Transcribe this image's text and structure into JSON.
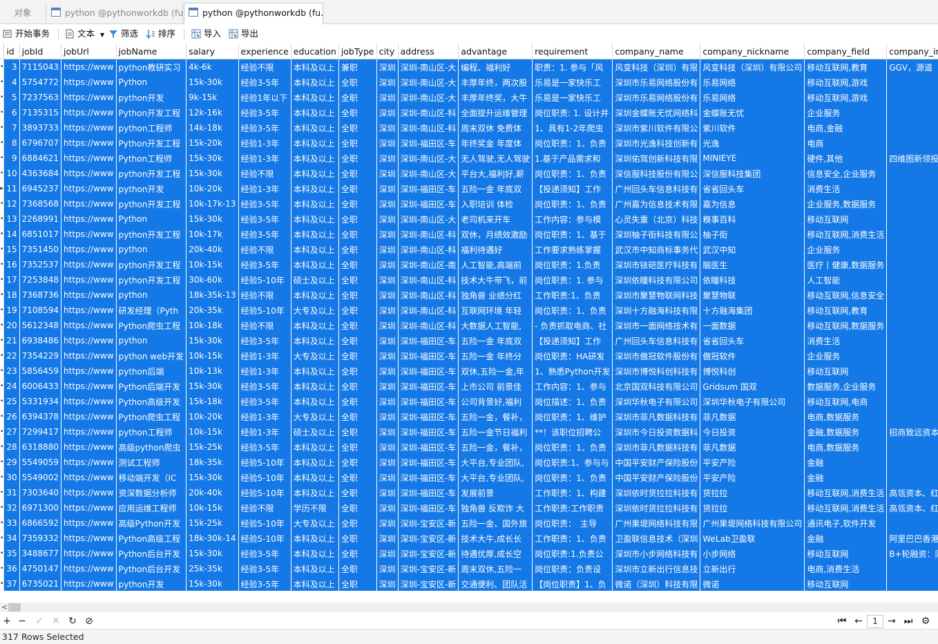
{
  "tabs": [
    {
      "label": "对象",
      "active": false
    },
    {
      "label": "python @pythonworkdb (fu...",
      "active": false
    },
    {
      "label": "python @pythonworkdb (fu...",
      "active": true
    }
  ],
  "toolbar": {
    "begin_transaction": "开始事务",
    "text": "文本",
    "filter": "筛选",
    "sort": "排序",
    "import": "导入",
    "export": "导出"
  },
  "columns": [
    "id",
    "jobId",
    "jobUrl",
    "jobName",
    "salary",
    "experience",
    "education",
    "jobType",
    "city",
    "address",
    "advantage",
    "requirement",
    "company_name",
    "company_nickname",
    "company_field",
    "company_in"
  ],
  "rows": [
    [
      "3",
      "7115043",
      "https://www",
      "python教研实习",
      "4k-6k",
      "经验不限",
      "本科及以上",
      "兼职",
      "深圳",
      "深圳-南山区-大",
      "编程、福利好",
      "职责：1. 参与「风",
      "风变科技（深圳）有限",
      "风变科技（深圳）有限公司",
      "移动互联网,教育",
      "GGV，源道"
    ],
    [
      "4",
      "5754772",
      "https://www",
      "Python",
      "15k-30k",
      "经验3-5年",
      "本科及以上",
      "全职",
      "深圳",
      "深圳-南山区-大",
      "丰厚年终，两次股",
      "乐易是一家快乐工",
      "深圳市乐易网络股份有",
      "乐易网络",
      "移动互联网,游戏",
      ""
    ],
    [
      "5",
      "7237563",
      "https://www",
      "python开发",
      "9k-15k",
      "经验1年以下",
      "本科及以上",
      "全职",
      "深圳",
      "深圳-南山区-大",
      "丰厚年终奖，大牛",
      "乐易是一家快乐工",
      "深圳市乐易网络股份有",
      "乐易网络",
      "移动互联网,游戏",
      ""
    ],
    [
      "6",
      "7135315",
      "https://www",
      "Python开发工程",
      "12k-16k",
      "经验3-5年",
      "本科及以上",
      "全职",
      "深圳",
      "深圳-南山区-科",
      "全面提升运维管理",
      "岗位职责: 1. 设计并",
      "深圳金蝶账无忧网络科",
      "金蝶账无忧",
      "企业服务",
      ""
    ],
    [
      "7",
      "3893733",
      "https://www",
      "python工程师",
      "14k-18k",
      "经验3-5年",
      "本科及以上",
      "全职",
      "深圳",
      "深圳-南山区-科",
      "周末双休 免费体",
      "1、具有1-2年爬虫",
      "深圳市紫川软件有限公",
      "紫川软件",
      "电商,金融",
      ""
    ],
    [
      "8",
      "6796707",
      "https://www",
      "Python开发工程",
      "15k-20k",
      "经验1-3年",
      "本科及以上",
      "全职",
      "深圳",
      "深圳-福田区-车",
      "年终奖金 年度体",
      "岗位职责：1、负责",
      "深圳市光逸科技创新有",
      "光逸",
      "电商",
      ""
    ],
    [
      "9",
      "6884621",
      "https://www",
      "Python工程师",
      "15k-30k",
      "经验1-3年",
      "本科及以上",
      "全职",
      "深圳",
      "深圳-南山区-大",
      "无人驾驶,无人驾驶",
      "1.基于产品需求和",
      "深圳佑驾创新科技有限",
      "MINIEYE",
      "硬件,其他",
      "四维图新领投"
    ],
    [
      "10",
      "4363684",
      "https://www",
      "python开发工程",
      "15k-30k",
      "经验不限",
      "本科及以上",
      "全职",
      "深圳",
      "深圳-南山区-大",
      "平台大,福利好,薪",
      "岗位职责：1、负责",
      "深信服科技股份有限公",
      "深信服科技集团",
      "信息安全,企业服务",
      ""
    ],
    [
      "11",
      "6945237",
      "https://www",
      "python开发",
      "10k-20k",
      "经验1-3年",
      "本科及以上",
      "全职",
      "深圳",
      "深圳-福田区-车",
      "五险一金 年底双",
      "【投递须知】工作",
      "广州回头车信息科技有",
      "省省回头车",
      "消费生活",
      ""
    ],
    [
      "12",
      "7368568",
      "https://www",
      "python开发工程",
      "10k-17k-13",
      "经验3-5年",
      "本科及以上",
      "全职",
      "深圳",
      "深圳-福田区-车",
      "入职培训 体检",
      "岗位职责：1、负责",
      "广州嘉为信息技术有限",
      "嘉为信息",
      "企业服务,数据服务",
      ""
    ],
    [
      "13",
      "2268991",
      "https://www",
      "Python",
      "15k-30k",
      "经验3-5年",
      "本科及以上",
      "全职",
      "深圳",
      "深圳-南山区-大",
      "老司机来开车",
      "工作内容：参与模",
      "心灵失重（北京）科技",
      "糗事百科",
      "移动互联网",
      ""
    ],
    [
      "14",
      "6851017",
      "https://www",
      "python开发工程",
      "10k-17k",
      "经验3-5年",
      "本科及以上",
      "全职",
      "深圳",
      "深圳-南山区-科",
      "双休，月绩效激励",
      "岗位职责：1、基于",
      "深圳柚子街科技有限公",
      "柚子街",
      "移动互联网,消费生活",
      ""
    ],
    [
      "15",
      "7351450",
      "https://www",
      "python",
      "20k-40k",
      "经验不限",
      "本科及以上",
      "全职",
      "深圳",
      "深圳-南山区-科",
      "福利待遇好",
      "工作要求熟练掌握",
      "武汉市中知商标事务代",
      "武汉中知",
      "企业服务",
      ""
    ],
    [
      "16",
      "7352537",
      "https://www",
      "python开发工程",
      "10k-15k",
      "经验3-5年",
      "本科及以上",
      "全职",
      "深圳",
      "深圳-南山区-南",
      "人工智能,高端前",
      "岗位职责：1.负责",
      "深圳市铱硙医疗科技有",
      "脑医生",
      "医疗丨健康,数据服务",
      ""
    ],
    [
      "17",
      "7253848",
      "https://www",
      "python开发工程",
      "30k-60k",
      "经验5-10年",
      "硕士及以上",
      "全职",
      "深圳",
      "深圳-南山区-科",
      "技术大牛带飞，前",
      "岗位职责：1. 参与",
      "深圳依瞳科技有限公司",
      "依瞳科技",
      "人工智能",
      ""
    ],
    [
      "18",
      "7368736",
      "https://www",
      "python",
      "18k-35k-13",
      "经验不限",
      "本科及以上",
      "全职",
      "深圳",
      "深圳-南山区-科",
      "独角兽 业绩分红",
      "工作职责:1、负责",
      "深圳市聚慧物联网科技",
      "聚慧物联",
      "移动互联网,信息安全",
      ""
    ],
    [
      "19",
      "7108594",
      "https://www",
      "研发经理（Pyth",
      "20k-35k",
      "经验5-10年",
      "大专及以上",
      "全职",
      "深圳",
      "深圳-南山区-科",
      "互联网环境 年轻",
      "岗位职责：1、负责",
      "深圳十方融海科技有限",
      "十方融海集团",
      "移动互联网,教育",
      ""
    ],
    [
      "20",
      "5612348",
      "https://www",
      "Python爬虫工程",
      "10k-18k",
      "经验不限",
      "本科及以上",
      "全职",
      "深圳",
      "深圳-南山区-科",
      "大数据人工智能,",
      "- 负责抓取电商、社",
      "深圳市一面网络技术有",
      "一面数据",
      "移动互联网,数据服务",
      ""
    ],
    [
      "21",
      "6938486",
      "https://www",
      "python",
      "15k-30k",
      "经验3-5年",
      "本科及以上",
      "全职",
      "深圳",
      "深圳-福田区-车",
      "五险一金 年底双",
      "【投递须知】工作",
      "广州回头车信息科技有",
      "省省回头车",
      "消费生活",
      ""
    ],
    [
      "22",
      "7354229",
      "https://www",
      "python web开发",
      "10k-15k",
      "经验1-3年",
      "大专及以上",
      "全职",
      "深圳",
      "深圳-福田区-车",
      "五险一金 年终分",
      "岗位职责：HA研发",
      "深圳市傲冠软件股份有",
      "傲冠软件",
      "企业服务",
      ""
    ],
    [
      "23",
      "5856459",
      "https://www",
      "python后端",
      "10k-13k",
      "经验1-3年",
      "本科及以上",
      "全职",
      "深圳",
      "深圳-福田区-车",
      "双休,五险一金,年",
      "1、熟悉Python开发",
      "深圳市博悦科创科技有",
      "博悦科创",
      "移动互联网",
      ""
    ],
    [
      "24",
      "6006433",
      "https://www",
      "Python后端开发",
      "15k-30k",
      "经验3-5年",
      "本科及以上",
      "全职",
      "深圳",
      "深圳-福田区-车",
      "上市公司 前景佳",
      "工作内容：1、参与",
      "北京国双科技有限公司",
      "Gridsum 国双",
      "数据服务,企业服务",
      ""
    ],
    [
      "25",
      "5331934",
      "https://www",
      "Python高级开发",
      "15k-18k",
      "经验3-5年",
      "本科及以上",
      "全职",
      "深圳",
      "深圳-福田区-车",
      "公司背景好,福利",
      "岗位描述：1、负责",
      "深圳华秋电子有限公司",
      "深圳华秋电子有限公司",
      "移动互联网,电商",
      ""
    ],
    [
      "26",
      "6394378",
      "https://www",
      "Python爬虫工程",
      "10k-20k",
      "经验1-3年",
      "大专及以上",
      "全职",
      "深圳",
      "深圳-福田区-车",
      "五险一金，餐补，",
      "岗位职责：1、维护",
      "深圳市菲凡数据科技有",
      "菲凡数据",
      "电商,数据服务",
      ""
    ],
    [
      "27",
      "7299417",
      "https://www",
      "python工程师",
      "10k-15k",
      "经验1-3年",
      "硕士及以上",
      "全职",
      "深圳",
      "深圳-福田区-车",
      "五险一金节日福利",
      "**！该职位招聘公",
      "深圳市今日投资数据科",
      "今日投资",
      "金融,数据服务",
      "招商致远资本"
    ],
    [
      "28",
      "6318880",
      "https://www",
      "高级python爬虫",
      "15k-25k",
      "经验3-5年",
      "本科及以上",
      "全职",
      "深圳",
      "深圳-福田区-车",
      "五险一金，餐补，",
      "岗位职责：1、负责",
      "深圳市菲凡数据科技有",
      "菲凡数据",
      "电商,数据服务",
      ""
    ],
    [
      "29",
      "5549059",
      "https://www",
      "测试工程师",
      "18k-35k",
      "经验5-10年",
      "本科及以上",
      "全职",
      "深圳",
      "深圳-福田区-车",
      "大平台,专业团队,",
      "岗位职责:1、参与与",
      "中国平安财产保险股份",
      "平安产险",
      "金融",
      ""
    ],
    [
      "30",
      "5549002",
      "https://www",
      "移动端开发（IC",
      "15k-30k",
      "经验5-10年",
      "本科及以上",
      "全职",
      "深圳",
      "深圳-福田区-车",
      "大平台,专业团队,",
      "岗位职责：1、负责",
      "中国平安财产保险股份",
      "平安产险",
      "金融",
      ""
    ],
    [
      "31",
      "7303640",
      "https://www",
      "资深数据分析师",
      "20k-40k",
      "经验5-10年",
      "本科及以上",
      "全职",
      "深圳",
      "深圳-福田区-车",
      "发展前景",
      "工作职责：1、构建",
      "深圳依时货拉拉科技有",
      "货拉拉",
      "移动互联网,消费生活",
      "高瓴资本、红"
    ],
    [
      "32",
      "6971300",
      "https://www",
      "应用运维工程师",
      "10k-15k",
      "经验不限",
      "学历不限",
      "全职",
      "深圳",
      "深圳-福田区-车",
      "独角兽 反欺诈 大",
      "工作职责:工作职责",
      "深圳依时货拉拉科技有",
      "货拉拉",
      "移动互联网,消费生活",
      "高瓴资本、红"
    ],
    [
      "33",
      "6866592",
      "https://www",
      "高级Python开发",
      "15k-25k",
      "经验5-10年",
      "大专及以上",
      "全职",
      "深圳",
      "深圳-宝安区-新",
      "五险一金、国外旅",
      "岗位职责：　主导",
      "广州果堤网络科技有限",
      "广州果堤网络科技有限公司",
      "通讯电子,软件开发",
      ""
    ],
    [
      "34",
      "7359332",
      "https://www",
      "Python高级工程",
      "18k-30k-14",
      "经验5-10年",
      "本科及以上",
      "全职",
      "深圳",
      "深圳-宝安区-新",
      "技术大牛,成长长",
      "工作职责：1、负责",
      "卫盈联信息技术（深圳",
      "WeLab卫盈联",
      "金融",
      "阿里巴巴香港"
    ],
    [
      "35",
      "3488677",
      "https://www",
      "Python后台开发",
      "15k-30k",
      "经验3-5年",
      "本科及以上",
      "全职",
      "深圳",
      "深圳-宝安区-新",
      "待遇优厚,成长空",
      "岗位职责:1.负责公",
      "深圳市小步网络科技有",
      "小步网络",
      "移动互联网",
      "B+轮融资：同"
    ],
    [
      "36",
      "4750147",
      "https://www",
      "Python后台开发",
      "25k-35k",
      "经验3-5年",
      "本科及以上",
      "全职",
      "深圳",
      "深圳-宝安区-新",
      "周末双休,五险一",
      "岗位职责：负责设",
      "深圳市立新出行信息技",
      "立新出行",
      "电商,消费生活",
      ""
    ],
    [
      "37",
      "6735021",
      "https://www",
      "python开发",
      "15k-30k",
      "经验3-5年",
      "本科及以上",
      "全职",
      "深圳",
      "深圳-宝安区-新",
      "交通便利、团队活",
      "【岗位职责】1、负",
      "微诺（深圳）科技有限",
      "微诺",
      "移动互联网",
      ""
    ]
  ],
  "pager": {
    "current_page": "1"
  },
  "status": {
    "selected_text": "317 Rows Selected"
  }
}
